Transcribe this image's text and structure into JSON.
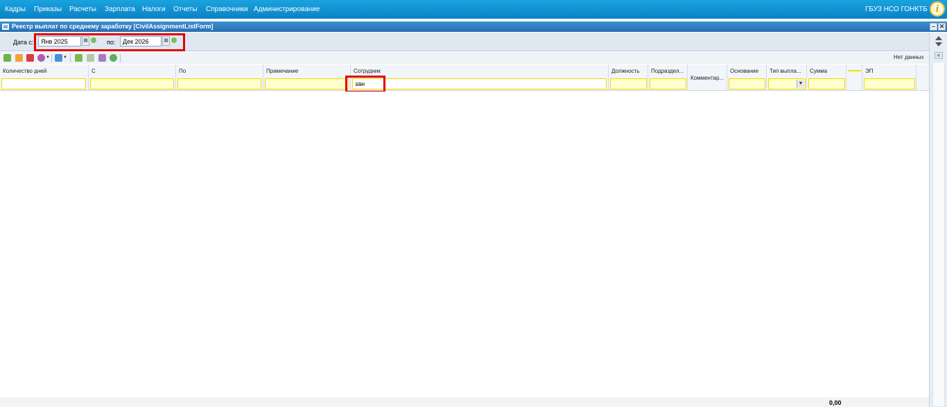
{
  "menu": {
    "items": [
      "Кадры",
      "Приказы",
      "Расчеты",
      "Зарплата",
      "Налоги",
      "Отчеты",
      "Справочники",
      "Администрирование"
    ],
    "organization": "ГБУЗ НСО ГОНКТБ",
    "info_icon_glyph": "i"
  },
  "window": {
    "title": "Реестр выплат по среднему заработку [CivilAssignmentListForm]",
    "minimize_glyph": "–",
    "close_glyph": "✕"
  },
  "filter": {
    "date_from_label": "Дата с:",
    "date_from_value": "Янв 2025",
    "date_to_label": "по:",
    "date_to_value": "Дек 2026"
  },
  "toolbar": {
    "no_data_label": "Нет данных",
    "icons": [
      "add-icon",
      "edit-icon",
      "delete-icon",
      "settings-icon",
      "print-icon",
      "mail-icon",
      "mail-disabled-icon",
      "sign-icon",
      "refresh-icon"
    ]
  },
  "grid": {
    "columns": {
      "days": "Количество дней",
      "from": "С",
      "to": "По",
      "note": "Примечание",
      "employee": "Сотрудник",
      "position": "Должность",
      "department": "Подраздел...",
      "comment": "Комментар...",
      "basis": "Основание",
      "payment_type": "Тип выпла...",
      "sum": "Сумма",
      "blank": "",
      "ep": "ЭП"
    },
    "filters": {
      "employee": "зан"
    }
  },
  "footer": {
    "total": "0,00"
  },
  "colors": {
    "menu_bar": "#0a82c5",
    "title_bar": "#2a6fb4",
    "filter_yellow": "#ffffcc",
    "highlight_red": "#e00000"
  }
}
